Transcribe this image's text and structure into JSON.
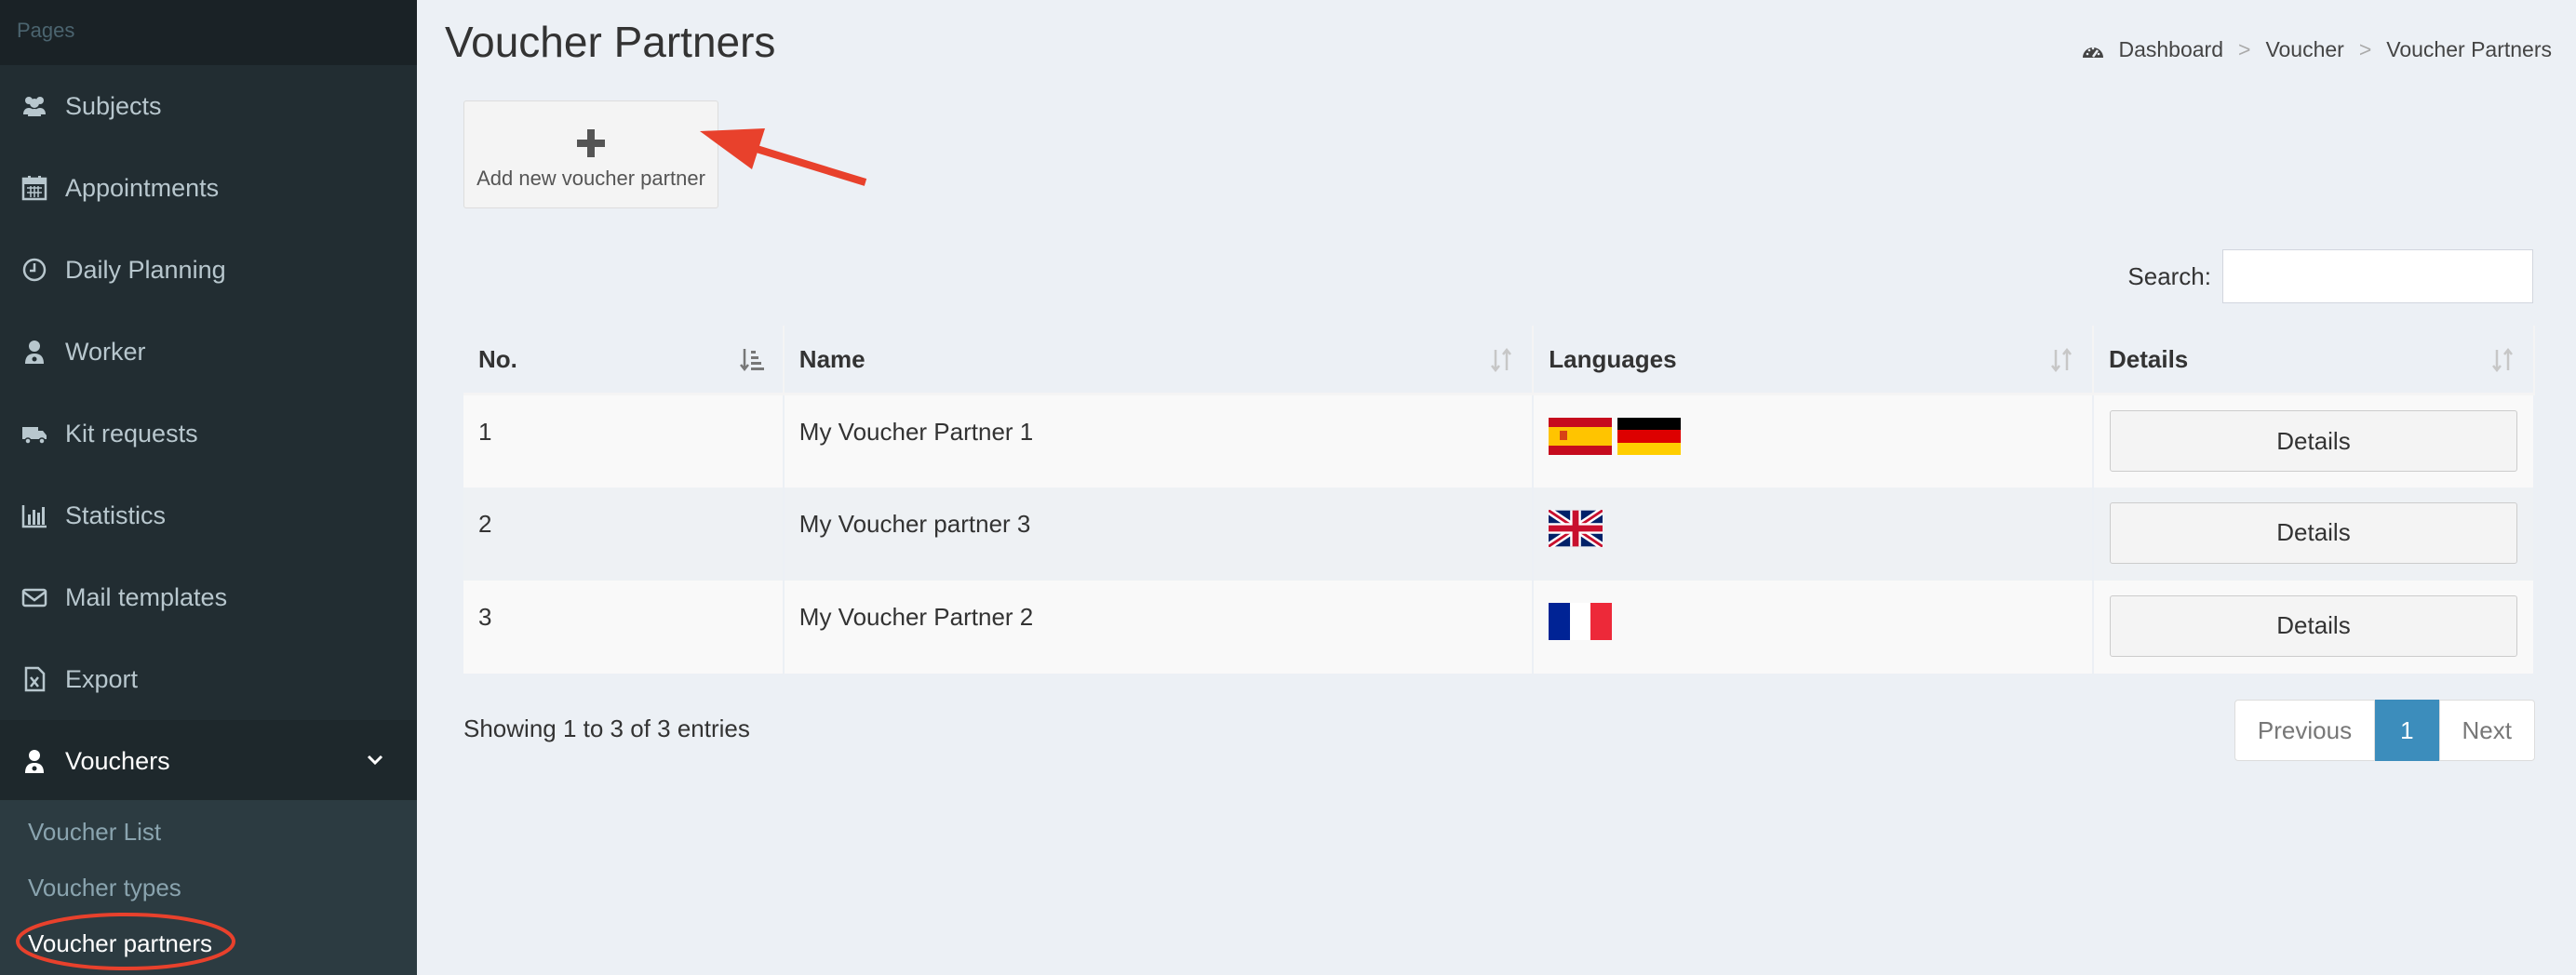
{
  "sidebar": {
    "header": "Pages",
    "items": [
      {
        "label": "Subjects",
        "icon": "users-icon"
      },
      {
        "label": "Appointments",
        "icon": "calendar-icon"
      },
      {
        "label": "Daily Planning",
        "icon": "clock-icon"
      },
      {
        "label": "Worker",
        "icon": "user-doctor-icon"
      },
      {
        "label": "Kit requests",
        "icon": "truck-icon"
      },
      {
        "label": "Statistics",
        "icon": "bar-chart-icon"
      },
      {
        "label": "Mail templates",
        "icon": "envelope-icon"
      },
      {
        "label": "Export",
        "icon": "file-excel-icon"
      },
      {
        "label": "Vouchers",
        "icon": "user-doctor-icon"
      }
    ],
    "submenu": [
      "Voucher List",
      "Voucher types",
      "Voucher partners"
    ]
  },
  "page": {
    "title": "Voucher Partners"
  },
  "breadcrumb": [
    "Dashboard",
    "Voucher",
    "Voucher Partners"
  ],
  "toolbar": {
    "add_label": "Add new voucher partner"
  },
  "search": {
    "label": "Search:",
    "value": ""
  },
  "table": {
    "headers": [
      "No.",
      "Name",
      "Languages",
      "Details"
    ],
    "rows": [
      {
        "no": "1",
        "name": "My Voucher Partner 1",
        "flags": [
          "es",
          "de"
        ],
        "details": "Details"
      },
      {
        "no": "2",
        "name": "My Voucher partner 3",
        "flags": [
          "gb"
        ],
        "details": "Details"
      },
      {
        "no": "3",
        "name": "My Voucher Partner 2",
        "flags": [
          "fr"
        ],
        "details": "Details"
      }
    ]
  },
  "footer": {
    "info": "Showing 1 to 3 of 3 entries"
  },
  "pagination": {
    "previous": "Previous",
    "current": "1",
    "next": "Next"
  },
  "colors": {
    "sidebar_bg": "#222d32",
    "content_bg": "#ecf0f5",
    "primary": "#3c8dbc",
    "annotation": "#e8412c"
  }
}
